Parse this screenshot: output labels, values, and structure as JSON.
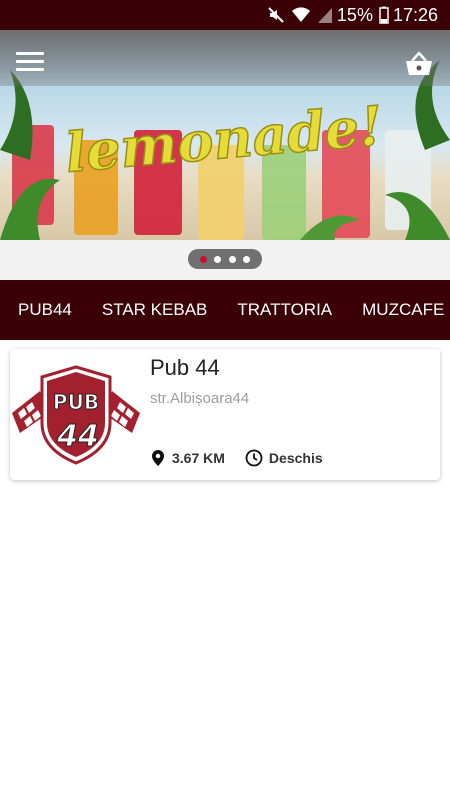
{
  "status_bar": {
    "battery_percent": "15%",
    "time": "17:26",
    "icons": [
      "mute-icon",
      "wifi-icon",
      "signal-icon",
      "battery-icon"
    ]
  },
  "app_bar": {
    "icons": [
      "menu-icon",
      "cart-icon"
    ]
  },
  "banner": {
    "text": "lemonade!",
    "slides_total": 4,
    "active_slide": 1
  },
  "tabs": [
    {
      "label": "PUB44",
      "active": true
    },
    {
      "label": "STAR KEBAB",
      "active": false
    },
    {
      "label": "TRATTORIA",
      "active": false
    },
    {
      "label": "MUZCAFE",
      "active": false
    }
  ],
  "restaurants": [
    {
      "name": "Pub 44",
      "address": "str.Albișoara44",
      "distance": "3.67 KM",
      "status": "Deschis",
      "logo_text_top": "PUB",
      "logo_text_bottom": "44"
    }
  ],
  "colors": {
    "brand_dark": "#3a0005",
    "logo_red": "#a3202f",
    "active_dot": "#c8102e"
  }
}
